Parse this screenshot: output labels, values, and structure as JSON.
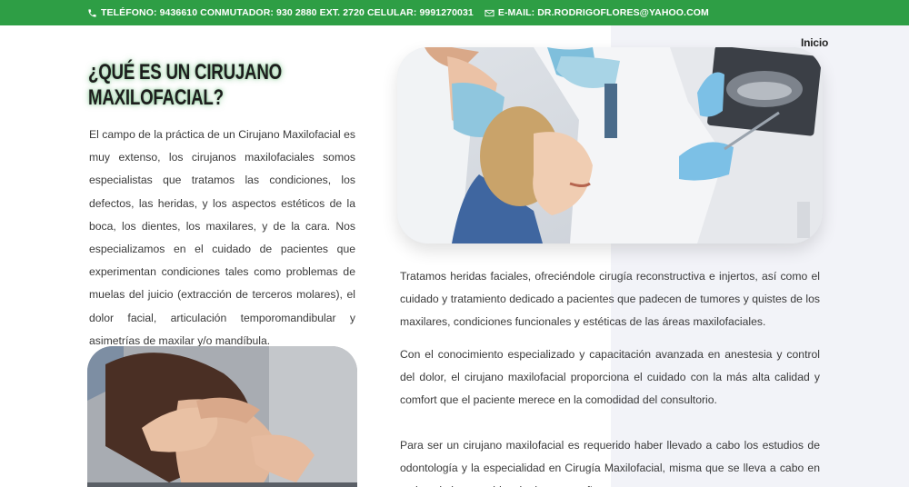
{
  "topbar": {
    "phone": "TELÉFONO: 9436610 CONMUTADOR: 930 2880 EXT. 2720 CELULAR: 9991270031",
    "email": "E-MAIL: DR.RODRIGOFLORES@YAHOO.COM",
    "phone_icon": "phone-icon",
    "email_icon": "envelope-icon",
    "bg_color": "#2e9e45"
  },
  "nav": {
    "inicio": "Inicio"
  },
  "main": {
    "heading": "¿Qué es un cirujano maxilofacial?",
    "intro": "El campo de la práctica de un Cirujano Maxilofacial es muy extenso, los cirujanos maxilofaciales somos especialistas que tratamos las condiciones, los defectos, las heridas, y los aspectos estéticos de la boca, los dientes, los maxilares, y de la cara. Nos especializamos en el cuidado de pacientes que experimentan condiciones tales como problemas de muelas del juicio (extracción de terceros molares), el dolor facial, articulación temporomandibular y asimetrías de maxilar y/o mandíbula.",
    "para1": "Tratamos heridas faciales, ofreciéndole cirugía reconstructiva e injertos, así como el cuidado y tratamiento dedicado a pacientes que padecen de tumores y quistes de los maxilares, condiciones funcionales y estéticas de las áreas maxilofaciales.",
    "para2": "Con el conocimiento especializado y capacitación avanzada en anestesia y control del dolor, el cirujano maxilofacial proporciona el cuidado con la más alta calidad y comfort que el paciente merece en la comodidad del consultorio.",
    "para3": "Para ser un cirujano maxilofacial es requerido haber llevado a cabo los estudios de odontología y la especialidad en Cirugía Maxilofacial, misma que se lleva a cabo en un hospital con residencia de cuatro años."
  }
}
